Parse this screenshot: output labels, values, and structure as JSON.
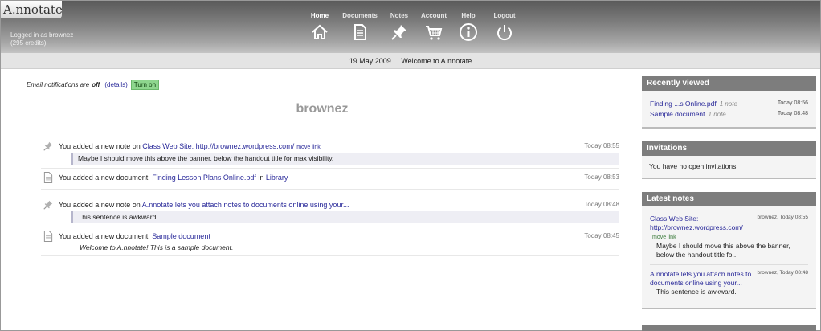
{
  "header": {
    "logo": "A.nnotate",
    "logged_in": "Logged in as brownez",
    "credits": "(295 credits)",
    "nav": [
      {
        "label": "Home",
        "icon": "home-icon",
        "active": true
      },
      {
        "label": "Documents",
        "icon": "document-icon"
      },
      {
        "label": "Notes",
        "icon": "pushpin-icon"
      },
      {
        "label": "Account",
        "icon": "cart-icon"
      },
      {
        "label": "Help",
        "icon": "info-icon"
      },
      {
        "label": "Logout",
        "icon": "power-icon"
      }
    ]
  },
  "datebar": {
    "date": "19 May 2009",
    "welcome": "Welcome to A.nnotate"
  },
  "email": {
    "prefix": "Email notifications are",
    "state": "off",
    "details": "(details)",
    "button": "Turn on"
  },
  "username": "brownez",
  "activity": [
    {
      "type": "note",
      "text": "You added a new note on",
      "link": "Class Web Site: http://brownez.wordpress.com/",
      "extra": "move link",
      "time": "Today 08:55",
      "quote": "Maybe I should move this above the banner, below the handout title for max visibility."
    },
    {
      "type": "document",
      "text": "You added a new document:",
      "link": "Finding Lesson Plans Online.pdf",
      "in": "in",
      "folder": "Library",
      "time": "Today 08:53"
    },
    {
      "type": "note",
      "text": "You added a new note on",
      "link": "A.nnotate lets you attach notes to documents online using your...",
      "time": "Today 08:48",
      "quote": "This sentence is awkward."
    },
    {
      "type": "document",
      "text": "You added a new document:",
      "link": "Sample document",
      "time": "Today 08:45",
      "desc": "Welcome to A.nnotate! This is a sample document."
    }
  ],
  "sidebar": {
    "recently_viewed": {
      "title": "Recently viewed",
      "items": [
        {
          "name": "Finding ...s Online.pdf",
          "count": "1 note",
          "time": "Today 08:56"
        },
        {
          "name": "Sample document",
          "count": "1 note",
          "time": "Today 08:48"
        }
      ]
    },
    "invitations": {
      "title": "Invitations",
      "text": "You have no open invitations."
    },
    "latest_notes": {
      "title": "Latest notes",
      "items": [
        {
          "link": "Class Web Site: http://brownez.wordpress.com/",
          "extra": "move link",
          "meta": "brownez, Today 08:55",
          "text": "Maybe I should move this above the banner, below the handout title fo..."
        },
        {
          "link": "A.nnotate lets you attach notes to documents online using your...",
          "meta": "brownez, Today 08:48",
          "text": "This sentence is awkward."
        }
      ]
    }
  }
}
